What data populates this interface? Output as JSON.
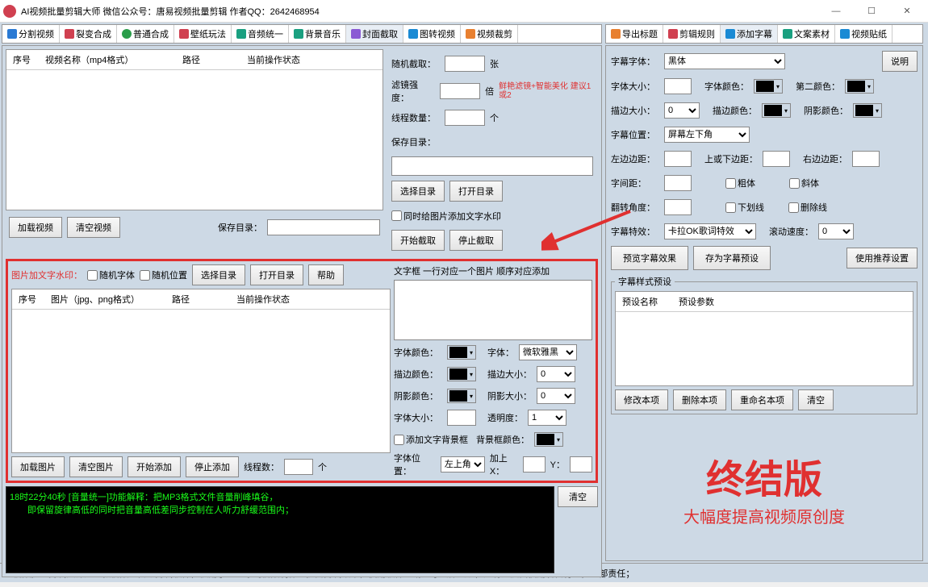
{
  "window": {
    "title": "AI视频批量剪辑大师   微信公众号：唐易视频批量剪辑   作者QQ：2642468954",
    "min": "—",
    "max": "☐",
    "close": "✕"
  },
  "left_tabs": [
    "分割视频",
    "裂变合成",
    "普通合成",
    "壁纸玩法",
    "音频统一",
    "背景音乐",
    "封面截取",
    "图转视频",
    "视频裁剪"
  ],
  "right_tabs": [
    "导出标题",
    "剪辑规则",
    "添加字幕",
    "文案素材",
    "视频贴纸"
  ],
  "video_list": {
    "h1": "序号",
    "h2": "视频名称（mp4格式）",
    "h3": "路径",
    "h4": "当前操作状态"
  },
  "buttons": {
    "load_video": "加载视频",
    "clear_video": "清空视频",
    "save_dir": "保存目录：",
    "select_dir": "选择目录",
    "open_dir": "打开目录",
    "start_capture": "开始截取",
    "stop_capture": "停止截取",
    "load_img": "加载图片",
    "clear_img": "清空图片",
    "start_add": "开始添加",
    "stop_add": "停止添加",
    "help": "帮助",
    "clear_log": "清空",
    "preview_sub": "预览字幕效果",
    "save_preset": "存为字幕预设",
    "use_rec": "使用推荐设置",
    "mod": "修改本项",
    "del": "删除本项",
    "rename": "重命名本项",
    "clear": "清空",
    "explain": "说明"
  },
  "cover": {
    "random": "随机截取：",
    "unit_zhang": "张",
    "filter": "滤镜强度：",
    "unit_bei": "倍",
    "tip": "鲜艳滤镜+智能美化 建议1或2",
    "threads": "线程数量：",
    "unit_ge": "个",
    "savedir": "保存目录：",
    "watermark": "同时给图片添加文字水印"
  },
  "img_panel": {
    "title": "图片加文字水印：",
    "rand_font": "随机字体",
    "rand_pos": "随机位置",
    "h1": "序号",
    "h2": "图片（jpg、png格式）",
    "h3": "路径",
    "h4": "当前操作状态",
    "threads": "线程数：",
    "unit": "个"
  },
  "textbox": {
    "title": "文字框 一行对应一个图片 顺序对应添加",
    "font_color": "字体颜色：",
    "font": "字体：",
    "font_val": "微软雅黑",
    "stroke_color": "描边颜色：",
    "stroke_size": "描边大小：",
    "stroke_val": "0",
    "shadow_color": "阴影颜色：",
    "shadow_size": "阴影大小：",
    "shadow_val": "0",
    "font_size": "字体大小：",
    "opacity": "透明度：",
    "opacity_val": "1",
    "add_bg": "添加文字背景框",
    "bg_color": "背景框颜色：",
    "pos": "字体位置：",
    "pos_val": "左上角",
    "addx": "加上X：",
    "y": "Y："
  },
  "log": {
    "line1": "18时22分40秒 [音量统一]功能解释：把MP3格式文件音量削峰填谷，",
    "line2": "　　即保留旋律高低的同时把音量高低差同步控制在人听力舒缓范围内；"
  },
  "brand": {
    "big": "终结版",
    "sub": "大幅度提高视频原创度"
  },
  "sub": {
    "font": "字幕字体：",
    "font_val": "黑体",
    "size": "字体大小：",
    "color": "字体颜色：",
    "color2": "第二颜色：",
    "stroke": "描边大小：",
    "stroke_val": "0",
    "stroke_color": "描边颜色：",
    "shadow_color": "阴影颜色：",
    "pos": "字幕位置：",
    "pos_val": "屏幕左下角",
    "left": "左边边距：",
    "top": "上或下边距：",
    "right": "右边边距：",
    "spacing": "字间距：",
    "bold": "粗体",
    "italic": "斜体",
    "rotate": "翻转角度：",
    "underline": "下划线",
    "strike": "删除线",
    "effect": "字幕特效：",
    "effect_val": "卡拉OK歌词特效",
    "speed": "滚动速度：",
    "speed_val": "0"
  },
  "preset": {
    "legend": "字幕样式预设",
    "h1": "预设名称",
    "h2": "预设参数"
  },
  "status": "AI视频批量剪辑大师是一款视频全自动剪辑软件，仅用于个人原创视频制作、提高剪辑效率，使用软件时请遵守法律法规，如有违反由使用者自行承担全部责任；"
}
